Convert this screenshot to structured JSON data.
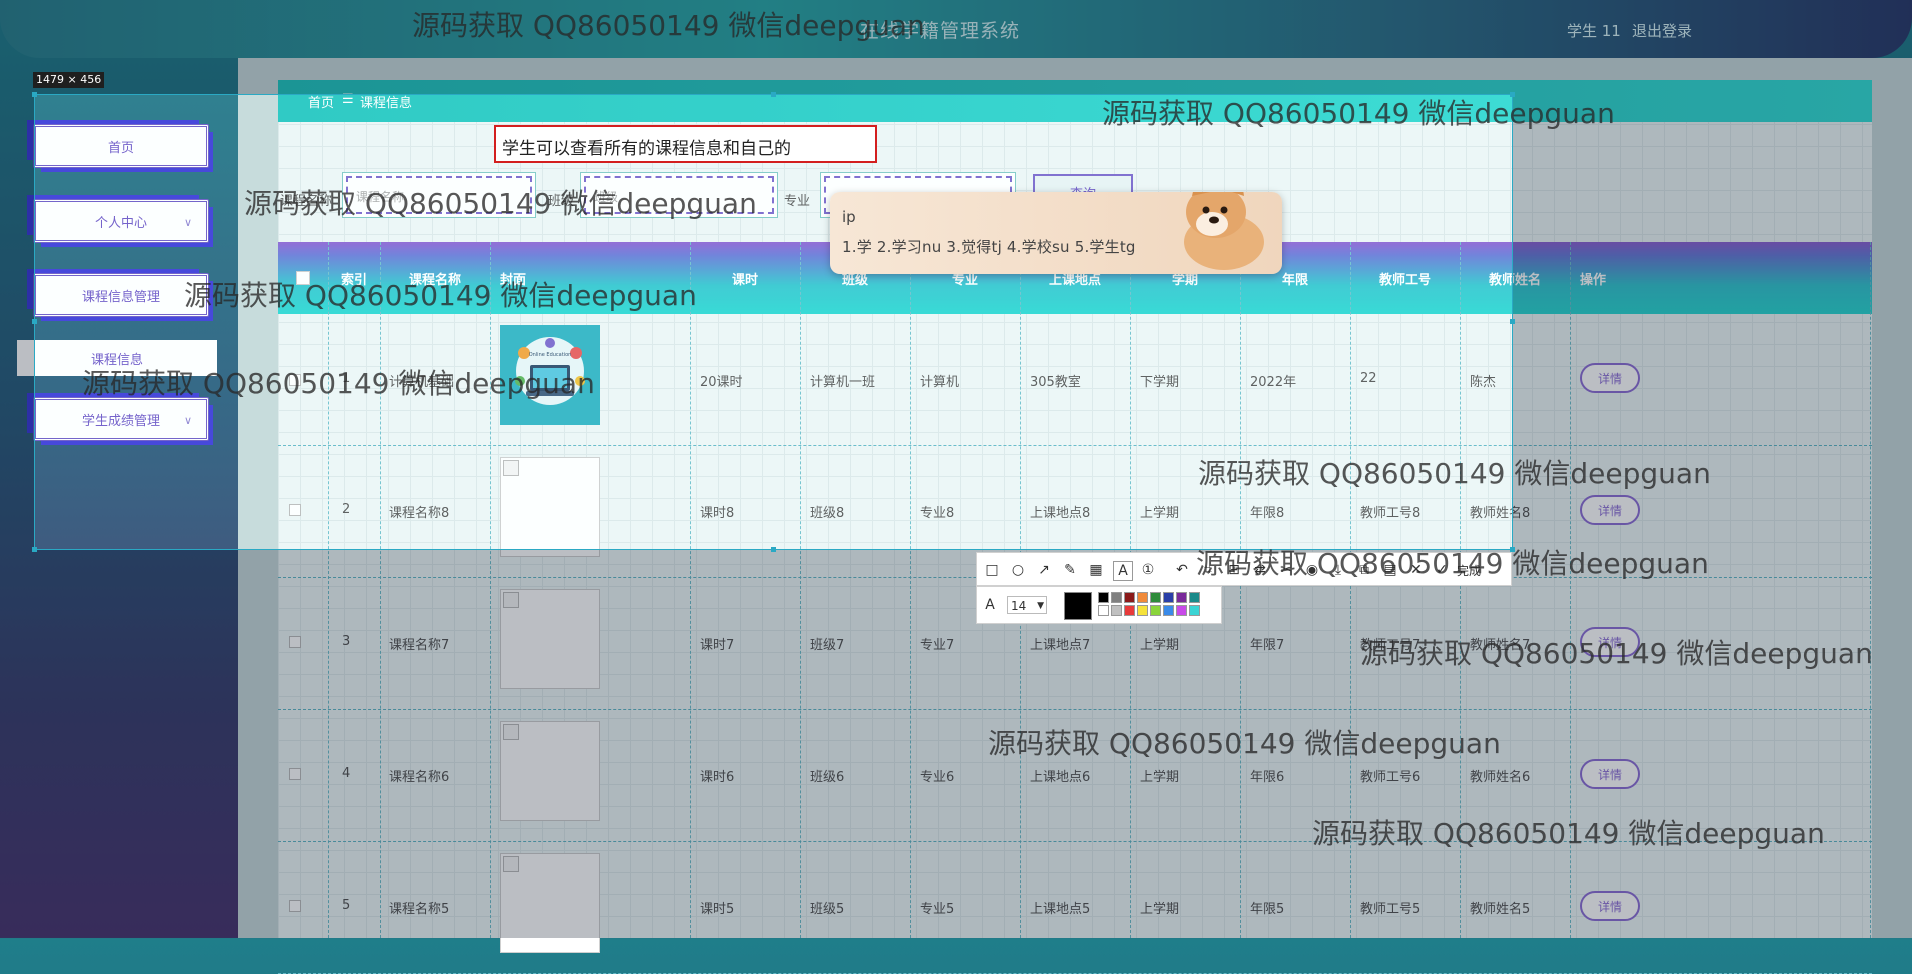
{
  "header": {
    "title": "在线学籍管理系统",
    "user": "学生 11",
    "logout": "退出登录"
  },
  "sidebar": {
    "home": "首页",
    "personal_center": "个人中心",
    "course_mgmt": "课程信息管理",
    "course_info": "课程信息",
    "grade_mgmt": "学生成绩管理"
  },
  "breadcrumb": {
    "home": "首页",
    "separator": "☰",
    "current": "课程信息"
  },
  "annotation_text": "学生可以查看所有的课程信息和自己的",
  "search": {
    "name_label": "课程名称",
    "name_placeholder": "课程名称",
    "class_label": "班级",
    "class_placeholder": "班级",
    "major_label": "专业",
    "query_button": "查询"
  },
  "ime": {
    "composition": "ip",
    "candidates": "1.学  2.学习nu  3.觉得tj  4.学校su  5.学生tg"
  },
  "selection_size": "1479 × 456",
  "table": {
    "headers": [
      "索引",
      "课程名称",
      "封面",
      "课时",
      "班级",
      "专业",
      "上课地点",
      "学期",
      "年限",
      "教师工号",
      "教师姓名",
      "操作"
    ],
    "rows": [
      {
        "index": "1",
        "name": "计算机基础",
        "cover": "Online Education",
        "hours": "20课时",
        "class": "计算机一班",
        "major": "计算机",
        "location": "305教室",
        "term": "下学期",
        "year": "2022年",
        "teacher_id": "22",
        "teacher_name": "陈杰",
        "action": "详情"
      },
      {
        "index": "2",
        "name": "课程名称8",
        "cover": "",
        "hours": "课时8",
        "class": "班级8",
        "major": "专业8",
        "location": "上课地点8",
        "term": "上学期",
        "year": "年限8",
        "teacher_id": "教师工号8",
        "teacher_name": "教师姓名8",
        "action": "详情"
      },
      {
        "index": "3",
        "name": "课程名称7",
        "cover": "",
        "hours": "课时7",
        "class": "班级7",
        "major": "专业7",
        "location": "上课地点7",
        "term": "上学期",
        "year": "年限7",
        "teacher_id": "教师工号7",
        "teacher_name": "教师姓名7",
        "action": "详情"
      },
      {
        "index": "4",
        "name": "课程名称6",
        "cover": "",
        "hours": "课时6",
        "class": "班级6",
        "major": "专业6",
        "location": "上课地点6",
        "term": "上学期",
        "year": "年限6",
        "teacher_id": "教师工号6",
        "teacher_name": "教师姓名6",
        "action": "详情"
      },
      {
        "index": "5",
        "name": "课程名称5",
        "cover": "",
        "hours": "课时5",
        "class": "班级5",
        "major": "专业5",
        "location": "上课地点5",
        "term": "上学期",
        "year": "年限5",
        "teacher_id": "教师工号5",
        "teacher_name": "教师姓名5",
        "action": "详情"
      }
    ]
  },
  "toolbar": {
    "font_size": "14",
    "done": "完成"
  },
  "watermark": "源码获取 QQ86050149 微信deepguan",
  "colors": {
    "accent": "#2bd8d3",
    "purple": "#8e6fd6",
    "annotation_red": "#d31f1f"
  }
}
